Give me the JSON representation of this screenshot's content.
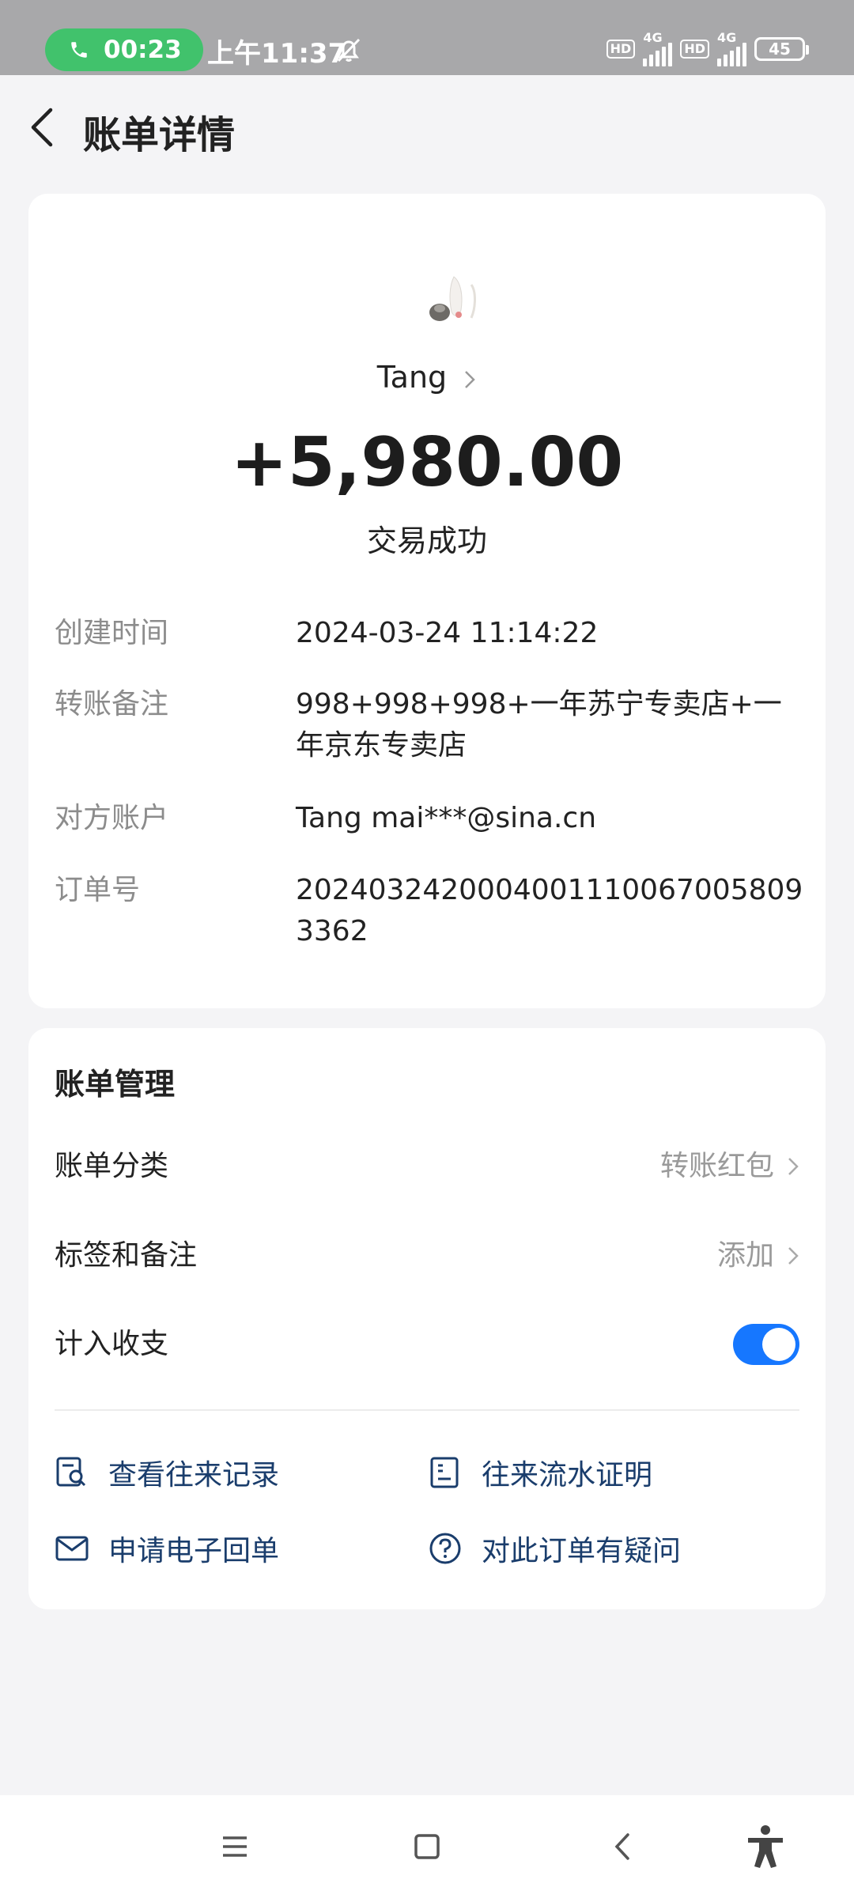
{
  "status_bar": {
    "call_duration": "00:23",
    "time": "上午11:37",
    "hd1": "HD",
    "net1": "4G",
    "hd2": "HD",
    "net2": "4G",
    "battery": "45"
  },
  "header": {
    "title": "账单详情"
  },
  "transaction": {
    "payer": "Tang",
    "amount": "+5,980.00",
    "status": "交易成功",
    "details": [
      {
        "label": "创建时间",
        "value": "2024-03-24 11:14:22"
      },
      {
        "label": "转账备注",
        "value": "998+998+998+一年苏宁专卖店+一年京东专卖店"
      },
      {
        "label": "对方账户",
        "value": "Tang mai***@sina.cn"
      },
      {
        "label": "订单号",
        "value": "20240324200040011100670058093362"
      }
    ]
  },
  "management": {
    "title": "账单管理",
    "category_label": "账单分类",
    "category_value": "转账红包",
    "tags_label": "标签和备注",
    "tags_value": "添加",
    "include_label": "计入收支",
    "include_enabled": true,
    "actions": [
      {
        "label": "查看往来记录",
        "icon": "search-record-icon"
      },
      {
        "label": "往来流水证明",
        "icon": "statement-icon"
      },
      {
        "label": "申请电子回单",
        "icon": "mail-icon"
      },
      {
        "label": "对此订单有疑问",
        "icon": "question-icon"
      }
    ]
  },
  "colors": {
    "accent": "#1677ff",
    "call_green": "#41c26c",
    "action_text": "#1a3d6c"
  }
}
